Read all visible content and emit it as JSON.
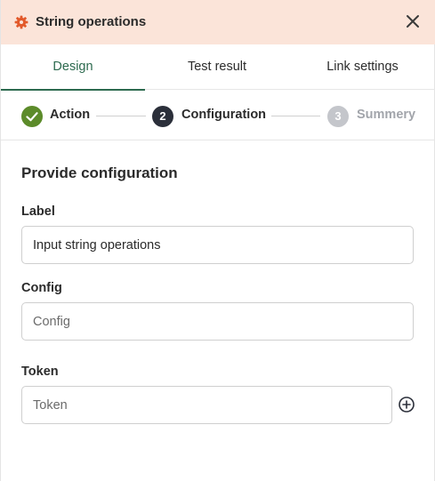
{
  "header": {
    "icon": "gear-icon",
    "title": "String operations",
    "close_icon": "close-icon",
    "background": "#fbe4d9",
    "icon_color": "#e2592a"
  },
  "tabs": [
    {
      "label": "Design",
      "active": true
    },
    {
      "label": "Test result",
      "active": false
    },
    {
      "label": "Link settings",
      "active": false
    }
  ],
  "accent": "#2d6a4f",
  "stepper": {
    "steps": [
      {
        "marker": "check-icon",
        "label": "Action",
        "state": "complete",
        "color": "#5c8b2a"
      },
      {
        "marker": "2",
        "label": "Configuration",
        "state": "current",
        "color": "#2b2f3a"
      },
      {
        "marker": "3",
        "label": "Summery",
        "state": "upcoming",
        "color": "#c4c6cb"
      }
    ]
  },
  "form": {
    "title": "Provide configuration",
    "fields": [
      {
        "label": "Label",
        "value": "Input string operations",
        "placeholder": ""
      },
      {
        "label": "Config",
        "value": "",
        "placeholder": "Config"
      },
      {
        "label": "Token",
        "value": "",
        "placeholder": "Token",
        "action_icon": "plus-circle-icon"
      }
    ]
  }
}
